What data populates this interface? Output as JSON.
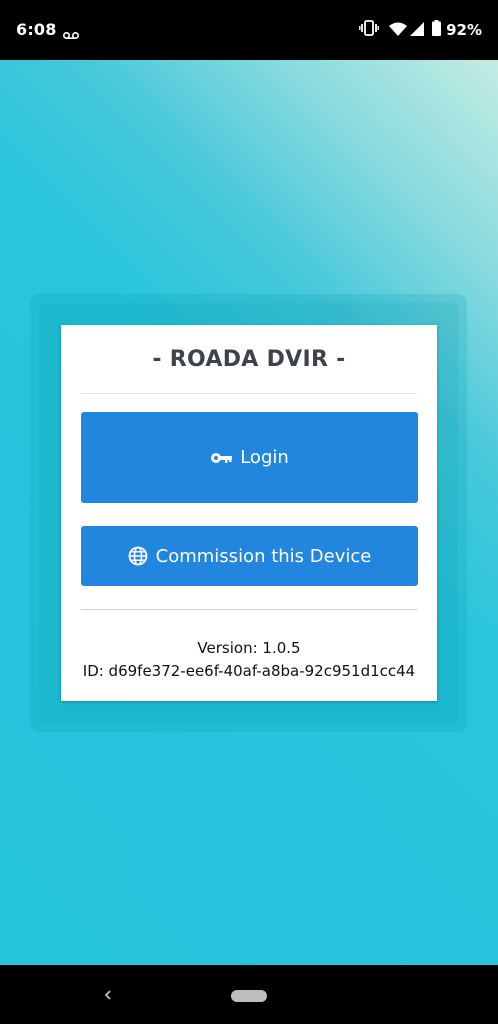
{
  "status_bar": {
    "time": "6:08",
    "battery_percent": "92%",
    "icons": [
      "voicemail-icon",
      "vibrate-icon",
      "wifi-icon",
      "signal-icon",
      "battery-icon"
    ]
  },
  "card": {
    "title": "- ROADA DVIR -",
    "login_label": "Login",
    "commission_label": "Commission this Device",
    "version": "Version: 1.0.5",
    "device_id": "ID: d69fe372-ee6f-40af-a8ba-92c951d1cc44"
  },
  "colors": {
    "button": "#2286de",
    "background": "#24c4db",
    "background_highlight": "#c3ece3",
    "title_text": "#3e4349"
  },
  "nav_bar": {
    "icons": [
      "back-icon",
      "home-pill"
    ]
  }
}
